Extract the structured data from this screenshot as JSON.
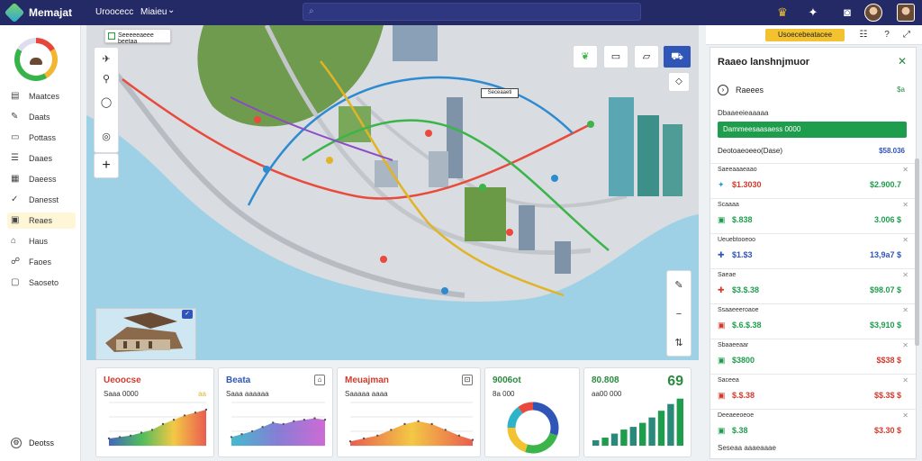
{
  "app": {
    "name": "Memajat",
    "nav": [
      "Uroocecc",
      "Miaieu"
    ]
  },
  "search": {
    "placeholder": ""
  },
  "sidebar": {
    "items": [
      {
        "icon": "grid-icon",
        "glyph": "▤",
        "label": "Maatces"
      },
      {
        "icon": "doc-icon",
        "glyph": "✎",
        "label": "Daats"
      },
      {
        "icon": "layers-icon",
        "glyph": "▭",
        "label": "Pottass"
      },
      {
        "icon": "list-icon",
        "glyph": "☰",
        "label": "Daaes"
      },
      {
        "icon": "chart-icon",
        "glyph": "▦",
        "label": "Daeess"
      },
      {
        "icon": "check-icon",
        "glyph": "✓",
        "label": "Danesst"
      },
      {
        "icon": "table-icon",
        "glyph": "▣",
        "label": "Reaes",
        "active": true
      },
      {
        "icon": "home-icon",
        "glyph": "⌂",
        "label": "Haus"
      },
      {
        "icon": "people-icon",
        "glyph": "☍",
        "label": "Faoes"
      },
      {
        "icon": "file-icon",
        "glyph": "▢",
        "label": "Saoseto"
      }
    ],
    "bottom": "Deotss"
  },
  "map": {
    "tooltip": "Seeeeeaeee beetaa",
    "label": "Seceaaeti"
  },
  "toolbar_top": {
    "chip": "Usoecebeatacee"
  },
  "cards": [
    {
      "title": "Ueoocse",
      "sub": "Saaa 0000",
      "badge": "aa",
      "title_color": "#d23a2c"
    },
    {
      "title": "Beata",
      "sub": "Saaa aaaaaa",
      "badge": "⌂",
      "title_color": "#2f55b7"
    },
    {
      "title": "Meuajman",
      "sub": "Saaaaa aaaa",
      "badge": "⊡",
      "title_color": "#d23a2c"
    },
    {
      "title": "9006ot",
      "sub": "8a 000",
      "badge": "",
      "title_color": "#2a8a3f"
    },
    {
      "title": "80.808",
      "sub": "aa00 000",
      "big": "69",
      "title_color": "#2a8a3f"
    }
  ],
  "panel": {
    "title": "Raaeo lanshnjmuor",
    "select": {
      "label": "Raeees",
      "value": "$a"
    },
    "section": "Dbaaeeieaaaaa",
    "bar": "Dammeesaasaess 0000",
    "row_a": "Deotoaeoeeo(Dase)",
    "row_b": "$58.036",
    "metrics": [
      {
        "label": "Saeeaaaeaao",
        "icon": "✦",
        "icon_color": "#2f9ad6",
        "value": "$1.3030",
        "value_color": "#d23a2c",
        "right": "$2.900.7",
        "right_color": "#1e9d4d"
      },
      {
        "label": "Scaaaa",
        "icon": "▣",
        "icon_color": "#1e9d4d",
        "value": "$.838",
        "value_color": "#1e9d4d",
        "right": "3.006 $",
        "right_color": "#1e9d4d"
      },
      {
        "label": "Ueuebtooeoo",
        "icon": "✚",
        "icon_color": "#2f55b7",
        "value": "$1.$3",
        "value_color": "#2f55b7",
        "right": "13,9a7 $",
        "right_color": "#2f55b7"
      },
      {
        "label": "Saeae",
        "icon": "✚",
        "icon_color": "#d23a2c",
        "value": "$3.$.38",
        "value_color": "#1e9d4d",
        "right": "$98.07 $",
        "right_color": "#1e9d4d"
      },
      {
        "label": "Ssaaeeeroaoe",
        "icon": "▣",
        "icon_color": "#d23a2c",
        "value": "$.6.$.38",
        "value_color": "#1e9d4d",
        "right": "$3,910 $",
        "right_color": "#1e9d4d"
      },
      {
        "label": "Sbaaeeaar",
        "icon": "▣",
        "icon_color": "#1e9d4d",
        "value": "$3800",
        "value_color": "#1e9d4d",
        "right": "$$38 $",
        "right_color": "#d23a2c"
      },
      {
        "label": "Saceea",
        "icon": "▣",
        "icon_color": "#d23a2c",
        "value": "$.$.38",
        "value_color": "#d23a2c",
        "right": "$$.3$ $",
        "right_color": "#d23a2c"
      },
      {
        "label": "Deeaeeoeoe",
        "icon": "▣",
        "icon_color": "#1e9d4d",
        "value": "$.38",
        "value_color": "#1e9d4d",
        "right": "$3.30 $",
        "right_color": "#d23a2c"
      }
    ],
    "footer": "Seseaa aaaeaaae"
  },
  "colors": {
    "brand": "#232a66",
    "accent_green": "#1e9d4d",
    "accent_red": "#d23a2c",
    "accent_blue": "#2f55b7"
  },
  "chart_data": [
    {
      "type": "area",
      "title": "Ueoocse",
      "values": [
        10,
        12,
        14,
        18,
        22,
        30,
        36,
        42,
        46,
        50
      ]
    },
    {
      "type": "area",
      "title": "Beata",
      "values": [
        12,
        16,
        20,
        26,
        32,
        30,
        34,
        36,
        38,
        36
      ]
    },
    {
      "type": "area",
      "title": "Meuajman",
      "values": [
        6,
        10,
        14,
        22,
        30,
        34,
        30,
        22,
        14,
        8
      ]
    },
    {
      "type": "pie",
      "title": "9006ot",
      "values": [
        30,
        25,
        20,
        15,
        10
      ]
    },
    {
      "type": "bar",
      "title": "80.808",
      "values": [
        8,
        12,
        18,
        24,
        28,
        34,
        42,
        52,
        62,
        70
      ]
    }
  ]
}
